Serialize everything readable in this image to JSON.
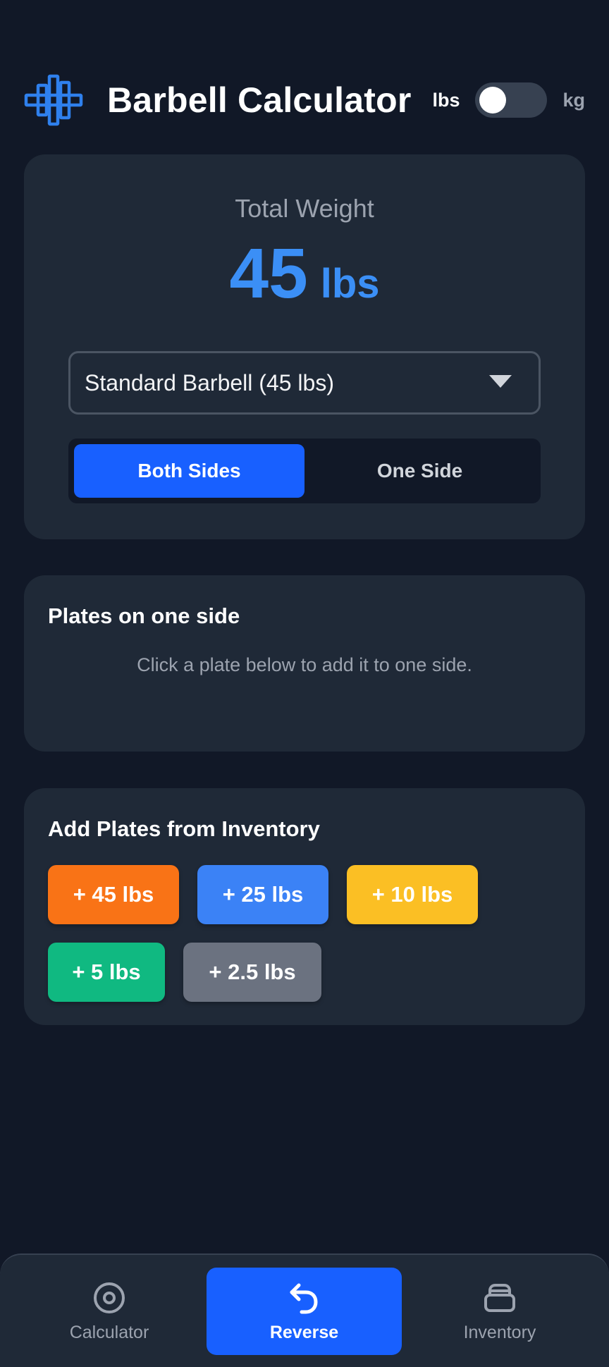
{
  "header": {
    "title": "Barbell Calculator",
    "unit_left": "lbs",
    "unit_right": "kg",
    "unit_selected": "lbs",
    "logo_icon": "barbell-icon"
  },
  "total": {
    "label": "Total Weight",
    "value": "45",
    "unit": "lbs"
  },
  "barbell_select": {
    "selected": "Standard Barbell (45 lbs)"
  },
  "mode": {
    "options": [
      "Both Sides",
      "One Side"
    ],
    "selected": "Both Sides"
  },
  "plates_on_side": {
    "title": "Plates on one side",
    "hint": "Click a plate below to add it to one side."
  },
  "inventory": {
    "title": "Add Plates from Inventory",
    "plates": [
      {
        "label": "+ 45 lbs",
        "color": "#f97316"
      },
      {
        "label": "+ 25 lbs",
        "color": "#3b82f6"
      },
      {
        "label": "+ 10 lbs",
        "color": "#fbbf24"
      },
      {
        "label": "+ 5 lbs",
        "color": "#10b981"
      },
      {
        "label": "+ 2.5 lbs",
        "color": "#6b7280"
      }
    ]
  },
  "nav": {
    "items": [
      {
        "label": "Calculator",
        "icon": "target-icon"
      },
      {
        "label": "Reverse",
        "icon": "undo-arrow-icon"
      },
      {
        "label": "Inventory",
        "icon": "stack-icon"
      }
    ],
    "active": "Reverse"
  },
  "colors": {
    "background": "#111827",
    "card": "#1f2937",
    "accent": "#1860ff",
    "total_value": "#3b8ff6"
  }
}
